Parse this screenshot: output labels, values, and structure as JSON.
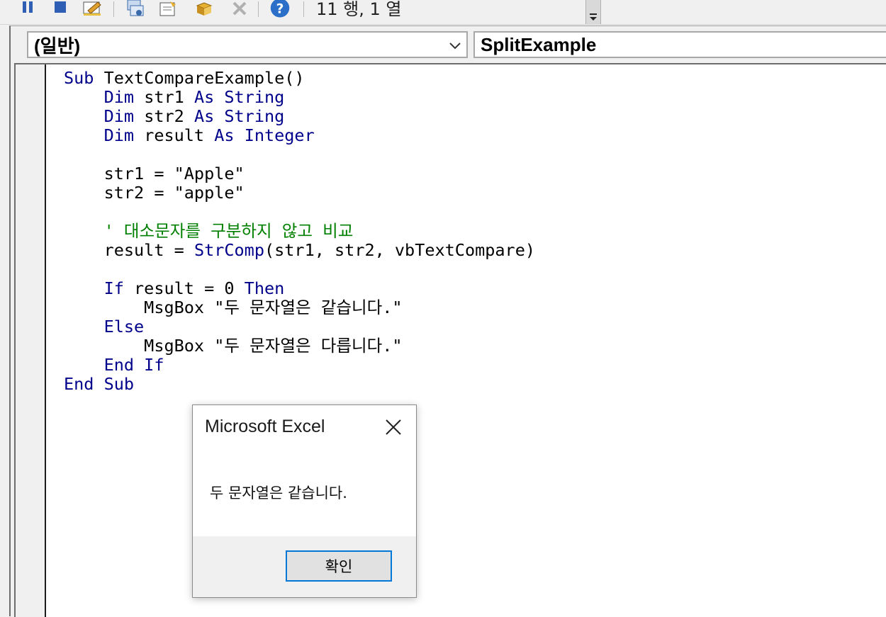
{
  "toolbar": {
    "icons": [
      "pause-icon",
      "stop-icon",
      "design-mode-icon",
      "project-explorer-icon",
      "properties-icon",
      "object-browser-icon",
      "toolbox-icon",
      "help-icon"
    ],
    "status_text": "11 행, 1 열"
  },
  "code_window": {
    "object_combo": "(일반)",
    "procedure_combo": "SplitExample",
    "code_lines": [
      [
        {
          "t": "Sub",
          "k": "kw"
        },
        {
          "t": " TextCompareExample()"
        }
      ],
      [
        {
          "t": "    "
        },
        {
          "t": "Dim",
          "k": "kw"
        },
        {
          "t": " str1 "
        },
        {
          "t": "As",
          "k": "kw"
        },
        {
          "t": " "
        },
        {
          "t": "String",
          "k": "kw"
        }
      ],
      [
        {
          "t": "    "
        },
        {
          "t": "Dim",
          "k": "kw"
        },
        {
          "t": " str2 "
        },
        {
          "t": "As",
          "k": "kw"
        },
        {
          "t": " "
        },
        {
          "t": "String",
          "k": "kw"
        }
      ],
      [
        {
          "t": "    "
        },
        {
          "t": "Dim",
          "k": "kw"
        },
        {
          "t": " result "
        },
        {
          "t": "As",
          "k": "kw"
        },
        {
          "t": " "
        },
        {
          "t": "Integer",
          "k": "kw"
        }
      ],
      [],
      [
        {
          "t": "    str1 = \"Apple\""
        }
      ],
      [
        {
          "t": "    str2 = \"apple\""
        }
      ],
      [],
      [
        {
          "t": "    "
        },
        {
          "t": "' 대소문자를 구분하지 않고 비교",
          "k": "cm"
        }
      ],
      [
        {
          "t": "    result = "
        },
        {
          "t": "StrComp",
          "k": "kw"
        },
        {
          "t": "(str1, str2, vbTextCompare)"
        }
      ],
      [],
      [
        {
          "t": "    "
        },
        {
          "t": "If",
          "k": "kw"
        },
        {
          "t": " result = 0 "
        },
        {
          "t": "Then",
          "k": "kw"
        }
      ],
      [
        {
          "t": "        MsgBox \"두 문자열은 같습니다.\""
        }
      ],
      [
        {
          "t": "    "
        },
        {
          "t": "Else",
          "k": "kw"
        }
      ],
      [
        {
          "t": "        MsgBox \"두 문자열은 다릅니다.\""
        }
      ],
      [
        {
          "t": "    "
        },
        {
          "t": "End If",
          "k": "kw"
        }
      ],
      [
        {
          "t": "End Sub",
          "k": "kw"
        }
      ]
    ]
  },
  "msgbox": {
    "title": "Microsoft Excel",
    "message": "두 문자열은 같습니다.",
    "ok_label": "확인"
  },
  "colors": {
    "keyword": "#00008b",
    "comment": "#008000",
    "button_focus": "#0078d7"
  }
}
